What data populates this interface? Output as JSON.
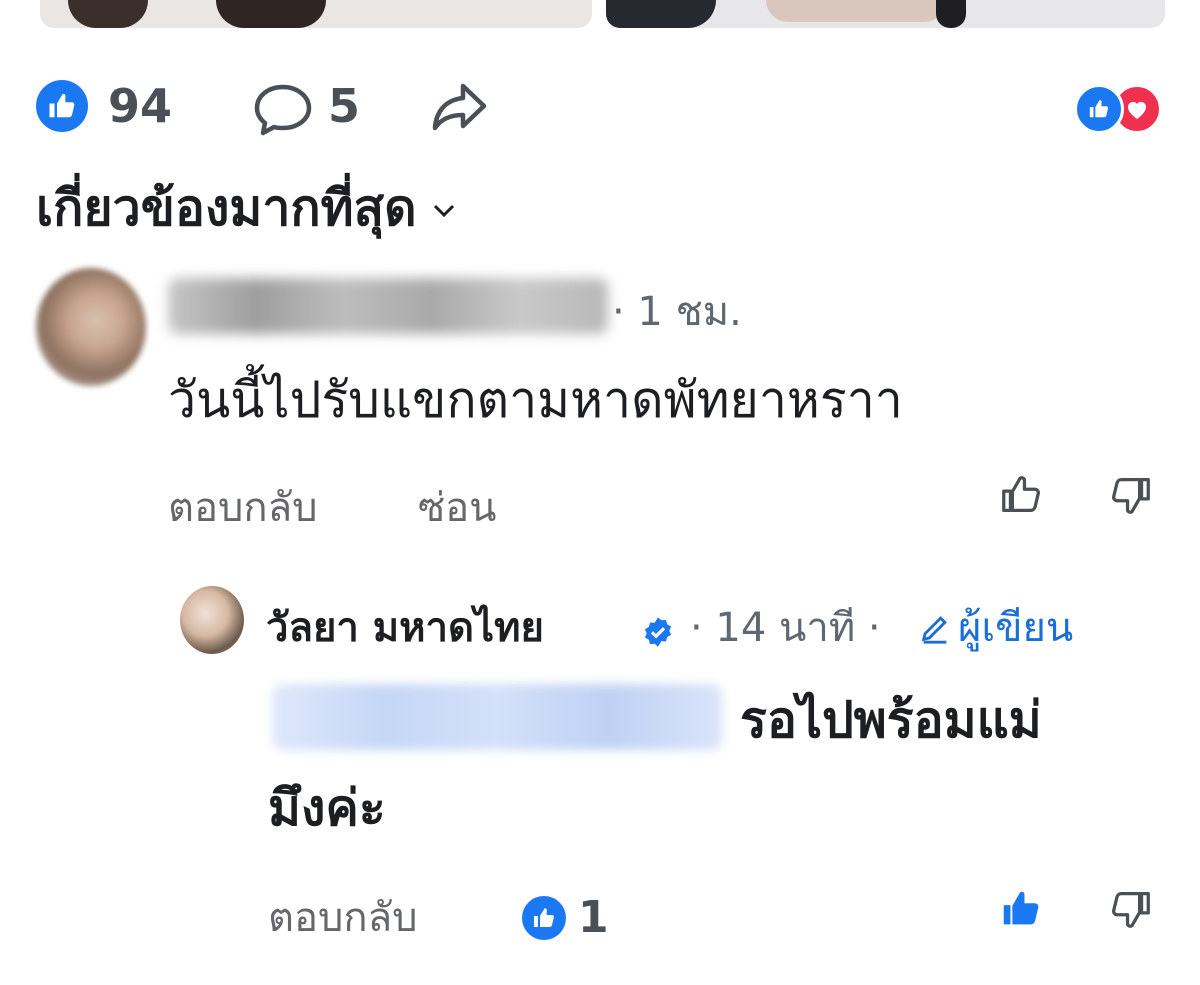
{
  "post": {
    "reactions": {
      "like_count": "94",
      "comment_count": "5"
    }
  },
  "sort": {
    "label": "เกี่ยวข้องมากที่สุด"
  },
  "comments": [
    {
      "time": "· 1 ชม.",
      "text": "วันนี้ไปรับแขกตามหาดพัทยาหราา",
      "actions": {
        "reply": "ตอบกลับ",
        "hide": "ซ่อน"
      }
    },
    {
      "author_name": "วัลยา มหาดไทย",
      "time": "· 14 นาที ·",
      "author_badge": "ผู้เขียน",
      "text_line1": "รอไปพร้อมแม่",
      "text_line2": "มึงค่ะ",
      "actions": {
        "reply": "ตอบกลับ"
      },
      "like_count": "1"
    }
  ],
  "colors": {
    "facebook_blue": "#1a78f2",
    "love_red": "#f0304f",
    "secondary_text": "#65676b"
  },
  "icons": [
    "like-icon",
    "comment-icon",
    "share-icon",
    "love-icon",
    "chevron-down-icon",
    "verified-icon",
    "pencil-icon",
    "thumbs-up-icon",
    "thumbs-down-icon"
  ]
}
